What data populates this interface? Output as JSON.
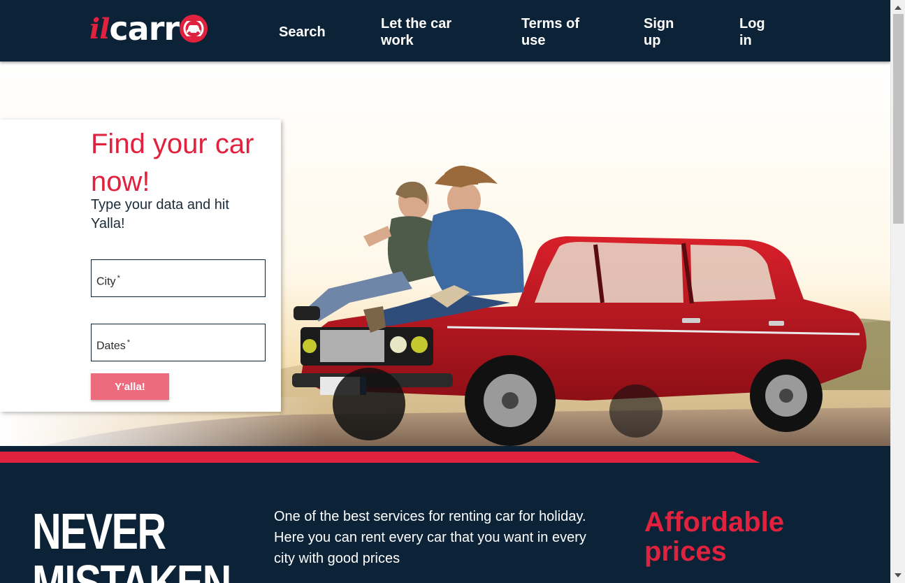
{
  "header": {
    "logo": {
      "part1": "il",
      "part2": "carr"
    },
    "nav": {
      "search": "Search",
      "let_car_work": "Let the car work",
      "terms": "Terms of use",
      "signup": "Sign up",
      "login": "Log in"
    }
  },
  "hero": {
    "title": "Find your car now!",
    "subtitle": "Type your data and hit Yalla!",
    "city_label": "City",
    "dates_label": "Dates",
    "required_mark": "*",
    "button": "Y'alla!"
  },
  "info": {
    "headline": "NEVER MISTAKEN",
    "description": "One of the best services for renting car for holiday. Here you can rent every car that you want in every city with good prices",
    "feature": "Affordable prices"
  },
  "colors": {
    "navy": "#0b2237",
    "brand_red": "#e0223f",
    "button_pink": "#ee6b7e"
  }
}
